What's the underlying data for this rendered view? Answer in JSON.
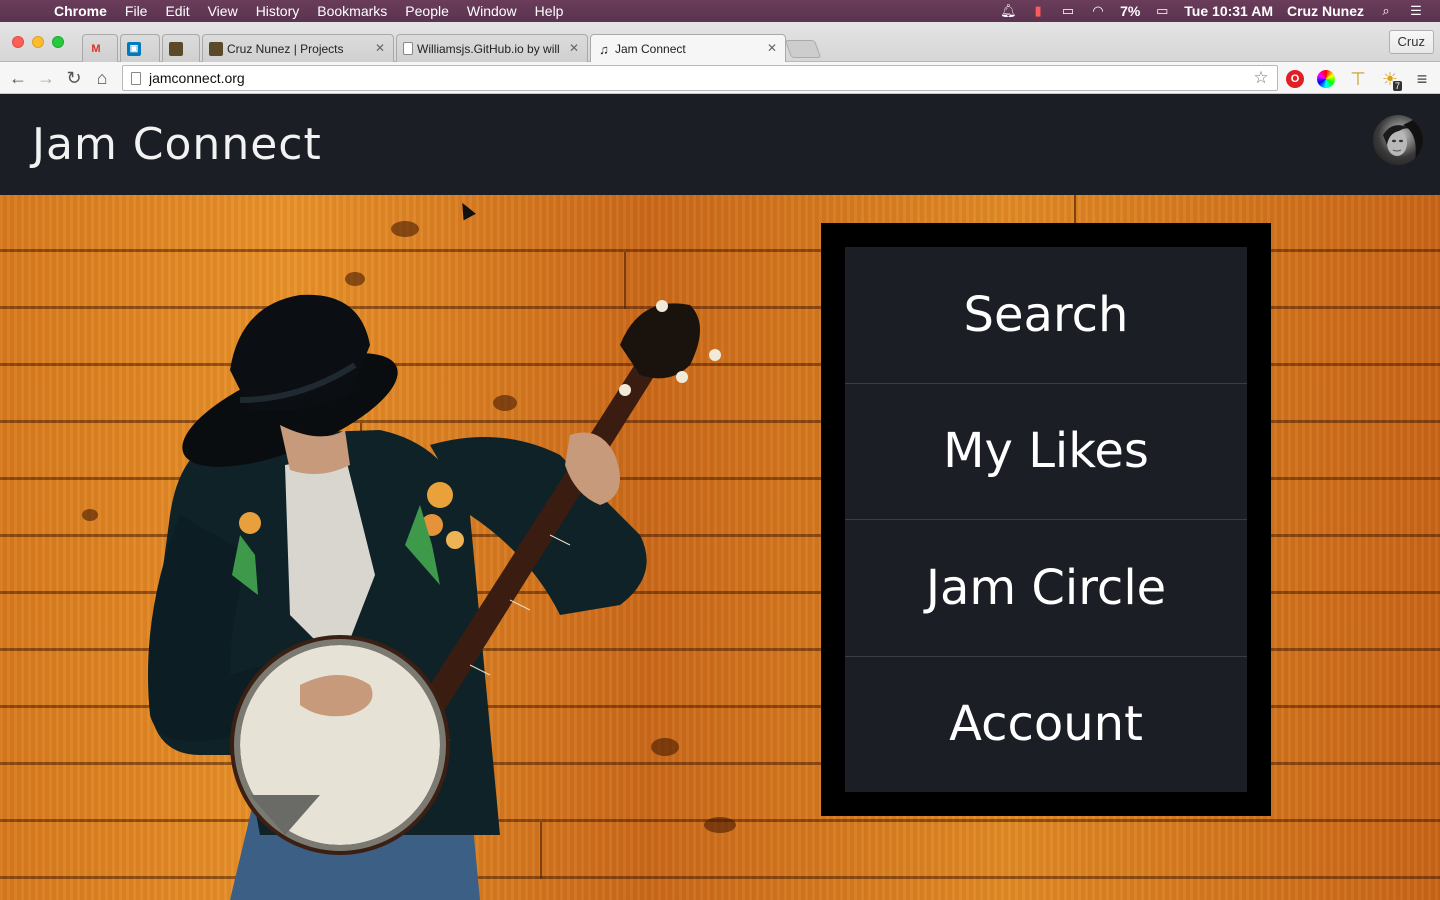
{
  "menubar": {
    "app_name": "Chrome",
    "items": [
      "File",
      "Edit",
      "View",
      "History",
      "Bookmarks",
      "People",
      "Window",
      "Help"
    ],
    "battery": "7%",
    "clock": "Tue 10:31 AM",
    "user": "Cruz Nunez"
  },
  "tabs": [
    {
      "label": "",
      "favicon": "gmail-icon",
      "icon_char": "M",
      "color": "#d93025"
    },
    {
      "label": "",
      "favicon": "trello-icon",
      "icon_char": "▣",
      "color": "#0079bf"
    },
    {
      "label": "",
      "favicon": "photo-icon",
      "icon_char": "▪",
      "color": "#5a4a2a"
    },
    {
      "label": "Cruz Nunez | Projects",
      "favicon": "photo-icon",
      "icon_char": "▪",
      "color": "#5a4a2a"
    },
    {
      "label": "Williamsjs.GitHub.io by will",
      "favicon": "page-icon",
      "icon_char": "▯",
      "color": "#888888"
    },
    {
      "label": "Jam Connect",
      "favicon": "music-note-icon",
      "icon_char": "♫",
      "color": "#222222"
    }
  ],
  "profile_button": "Cruz",
  "toolbar": {
    "url": "jamconnect.org",
    "extension_badge": "7"
  },
  "site": {
    "title": "Jam Connect",
    "brand_dark": "#1b1e24",
    "menu": [
      {
        "label": "Search"
      },
      {
        "label": "My Likes"
      },
      {
        "label": "Jam Circle"
      },
      {
        "label": "Account"
      }
    ]
  }
}
